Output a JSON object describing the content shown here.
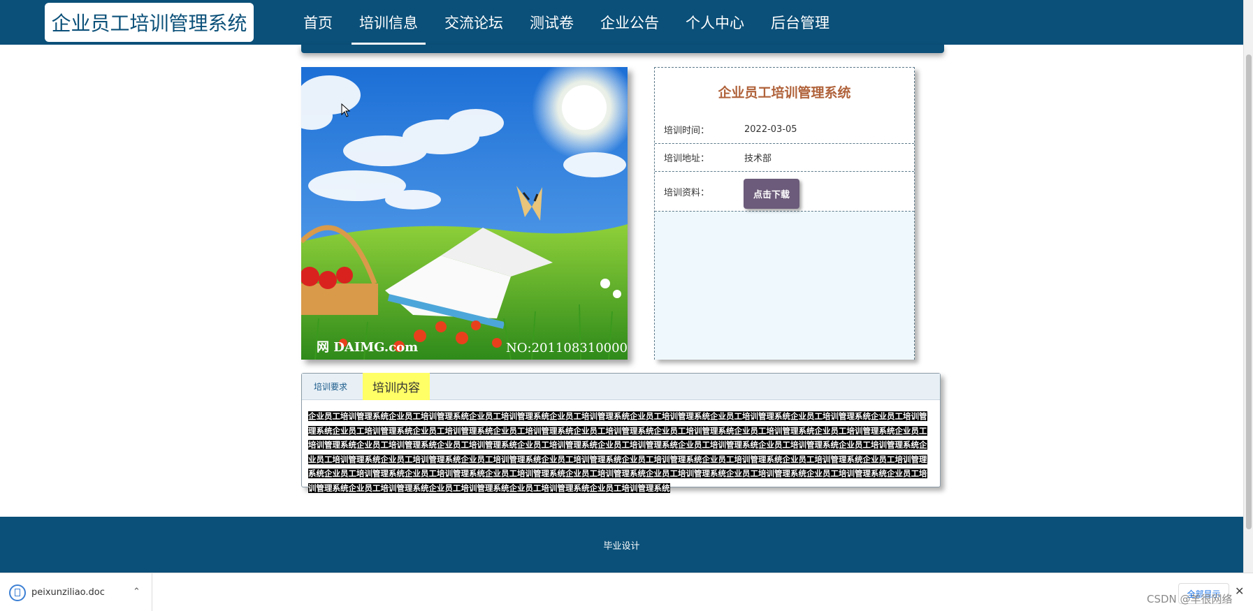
{
  "header": {
    "logo_text": "企业员工培训管理系统",
    "nav": [
      {
        "label": "首页",
        "active": false
      },
      {
        "label": "培训信息",
        "active": true
      },
      {
        "label": "交流论坛",
        "active": false
      },
      {
        "label": "测试卷",
        "active": false
      },
      {
        "label": "企业公告",
        "active": false
      },
      {
        "label": "个人中心",
        "active": false
      },
      {
        "label": "后台管理",
        "active": false
      }
    ]
  },
  "hero": {
    "watermark_left": "网 DAIMG.com",
    "watermark_right": "NO:201108310000"
  },
  "info": {
    "title": "企业员工培训管理系统",
    "time_label": "培训时间：",
    "time_value": "2022-03-05",
    "address_label": "培训地址：",
    "address_value": "技术部",
    "material_label": "培训资料：",
    "download_label": "点击下载"
  },
  "tabs": {
    "requirements_label": "培训要求",
    "content_label": "培训内容",
    "content_text": "企业员工培训管理系统企业员工培训管理系统企业员工培训管理系统企业员工培训管理系统企业员工培训管理系统企业员工培训管理系统企业员工培训管理系统企业员工培训管理系统企业员工培训管理系统企业员工培训管理系统企业员工培训管理系统企业员工培训管理系统企业员工培训管理系统企业员工培训管理系统企业员工培训管理系统企业员工培训管理系统企业员工培训管理系统企业员工培训管理系统企业员工培训管理系统企业员工培训管理系统企业员工培训管理系统企业员工培训管理系统企业员工培训管理系统企业员工培训管理系统企业员工培训管理系统企业员工培训管理系统企业员工培训管理系统企业员工培训管理系统企业员工培训管理系统企业员工培训管理系统企业员工培训管理系统企业员工培训管理系统企业员工培训管理系统企业员工培训管理系统企业员工培训管理系统企业员工培训管理系统企业员工培训管理系统企业员工培训管理系统企业员工培训管理系统企业员工培训管理系统企业员工培训管理系统企业员工培训管理系统企业员工培训管理系统"
  },
  "footer": {
    "text": "毕业设计"
  },
  "download_bar": {
    "filename": "peixunziliao.doc",
    "show_all": "全部显示",
    "watermark": "CSDN @羊很网络"
  },
  "colors": {
    "primary": "#0b5079",
    "title_accent": "#b0623a",
    "button": "#6c5b7a",
    "tab_highlight": "#ffff66",
    "panel_fill": "#eff9fd"
  }
}
